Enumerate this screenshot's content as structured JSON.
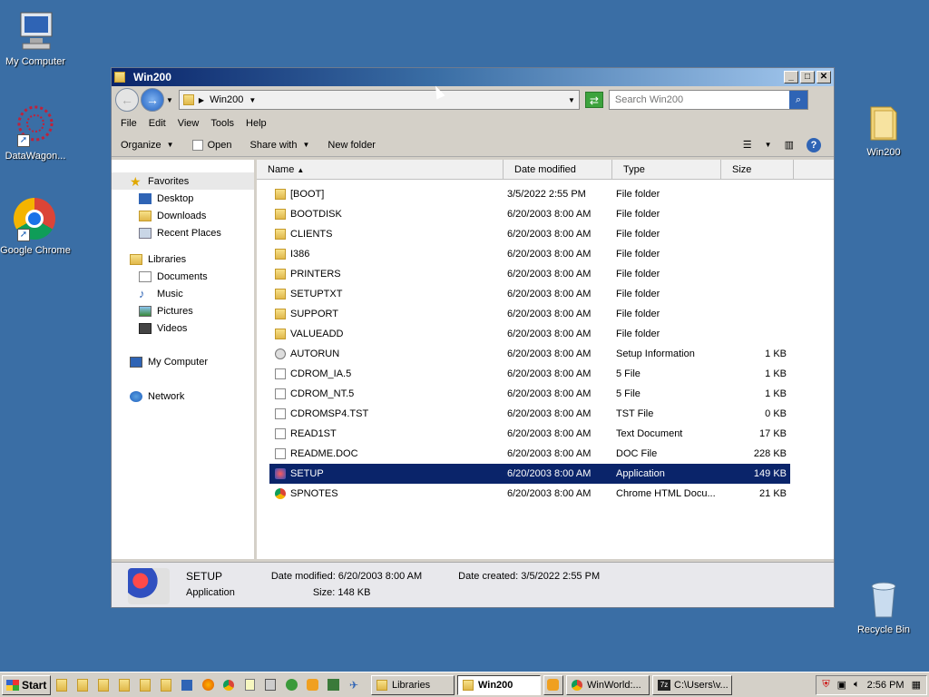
{
  "desktop": {
    "icons": [
      {
        "label": "My Computer"
      },
      {
        "label": "DataWagon..."
      },
      {
        "label": "Google Chrome"
      },
      {
        "label": "Win200"
      },
      {
        "label": "Recycle Bin"
      }
    ]
  },
  "window": {
    "title": "Win200",
    "address": {
      "crumb": "Win200"
    },
    "search": {
      "placeholder": "Search Win200"
    },
    "menu": [
      "File",
      "Edit",
      "View",
      "Tools",
      "Help"
    ],
    "commands": {
      "organize": "Organize",
      "open": "Open",
      "share": "Share with",
      "new_folder": "New folder"
    },
    "nav": {
      "favorites": "Favorites",
      "desktop": "Desktop",
      "downloads": "Downloads",
      "recent": "Recent Places",
      "libraries": "Libraries",
      "documents": "Documents",
      "music": "Music",
      "pictures": "Pictures",
      "videos": "Videos",
      "computer": "My Computer",
      "network": "Network"
    },
    "columns": {
      "name": "Name",
      "date": "Date modified",
      "type": "Type",
      "size": "Size"
    },
    "files": [
      {
        "name": "[BOOT]",
        "date": "3/5/2022 2:55 PM",
        "type": "File folder",
        "size": ""
      },
      {
        "name": "BOOTDISK",
        "date": "6/20/2003 8:00 AM",
        "type": "File folder",
        "size": ""
      },
      {
        "name": "CLIENTS",
        "date": "6/20/2003 8:00 AM",
        "type": "File folder",
        "size": ""
      },
      {
        "name": "I386",
        "date": "6/20/2003 8:00 AM",
        "type": "File folder",
        "size": ""
      },
      {
        "name": "PRINTERS",
        "date": "6/20/2003 8:00 AM",
        "type": "File folder",
        "size": ""
      },
      {
        "name": "SETUPTXT",
        "date": "6/20/2003 8:00 AM",
        "type": "File folder",
        "size": ""
      },
      {
        "name": "SUPPORT",
        "date": "6/20/2003 8:00 AM",
        "type": "File folder",
        "size": ""
      },
      {
        "name": "VALUEADD",
        "date": "6/20/2003 8:00 AM",
        "type": "File folder",
        "size": ""
      },
      {
        "name": "AUTORUN",
        "date": "6/20/2003 8:00 AM",
        "type": "Setup Information",
        "size": "1 KB"
      },
      {
        "name": "CDROM_IA.5",
        "date": "6/20/2003 8:00 AM",
        "type": "5 File",
        "size": "1 KB"
      },
      {
        "name": "CDROM_NT.5",
        "date": "6/20/2003 8:00 AM",
        "type": "5 File",
        "size": "1 KB"
      },
      {
        "name": "CDROMSP4.TST",
        "date": "6/20/2003 8:00 AM",
        "type": "TST File",
        "size": "0 KB"
      },
      {
        "name": "READ1ST",
        "date": "6/20/2003 8:00 AM",
        "type": "Text Document",
        "size": "17 KB"
      },
      {
        "name": "README.DOC",
        "date": "6/20/2003 8:00 AM",
        "type": "DOC File",
        "size": "228 KB"
      },
      {
        "name": "SETUP",
        "date": "6/20/2003 8:00 AM",
        "type": "Application",
        "size": "149 KB"
      },
      {
        "name": "SPNOTES",
        "date": "6/20/2003 8:00 AM",
        "type": "Chrome HTML Docu...",
        "size": "21 KB"
      }
    ],
    "details": {
      "name": "SETUP",
      "kind": "Application",
      "modified": "Date modified: 6/20/2003 8:00 AM",
      "size": "Size:  148 KB",
      "created": "Date created: 3/5/2022 2:55 PM"
    }
  },
  "taskbar": {
    "start": "Start",
    "tasks": [
      "Libraries",
      "Win200",
      "WinWorld:...",
      "C:\\Users\\v..."
    ],
    "clock": "2:56 PM"
  }
}
